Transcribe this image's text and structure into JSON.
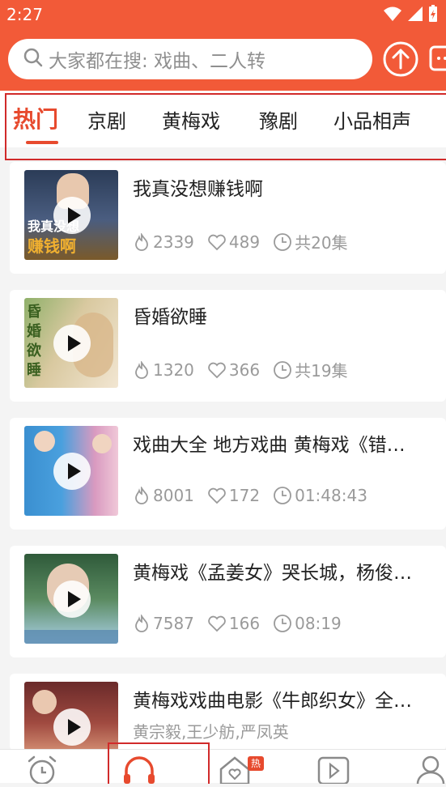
{
  "status_bar": {
    "time": "2:27"
  },
  "search": {
    "placeholder": "大家都在搜: 戏曲、二人转"
  },
  "tabs": [
    {
      "label": "热门",
      "active": true
    },
    {
      "label": "京剧",
      "active": false
    },
    {
      "label": "黄梅戏",
      "active": false
    },
    {
      "label": "豫剧",
      "active": false
    },
    {
      "label": "小品相声",
      "active": false
    }
  ],
  "videos": [
    {
      "title": "我真没想赚钱啊",
      "plays": "2339",
      "likes": "489",
      "duration": "共20集"
    },
    {
      "title": "昏婚欲睡",
      "plays": "1320",
      "likes": "366",
      "duration": "共19集"
    },
    {
      "title": "戏曲大全 地方戏曲 黄梅戏《错…",
      "plays": "8001",
      "likes": "172",
      "duration": "01:48:43"
    },
    {
      "title": "黄梅戏《孟姜女》哭长城，杨俊…",
      "plays": "7587",
      "likes": "166",
      "duration": "08:19"
    },
    {
      "title": "黄梅戏戏曲电影《牛郎织女》全…",
      "artists": "黄宗毅,王少舫,严凤英"
    }
  ],
  "thumb_texts": [
    "我真没想",
    "赚钱啊",
    "昏",
    "婚",
    "欲",
    "睡"
  ],
  "bottom_nav": {
    "hot_badge": "热"
  },
  "colors": {
    "brand": "#f25a38",
    "accent": "#e74a2e",
    "highlight_box": "#d12a2a"
  }
}
